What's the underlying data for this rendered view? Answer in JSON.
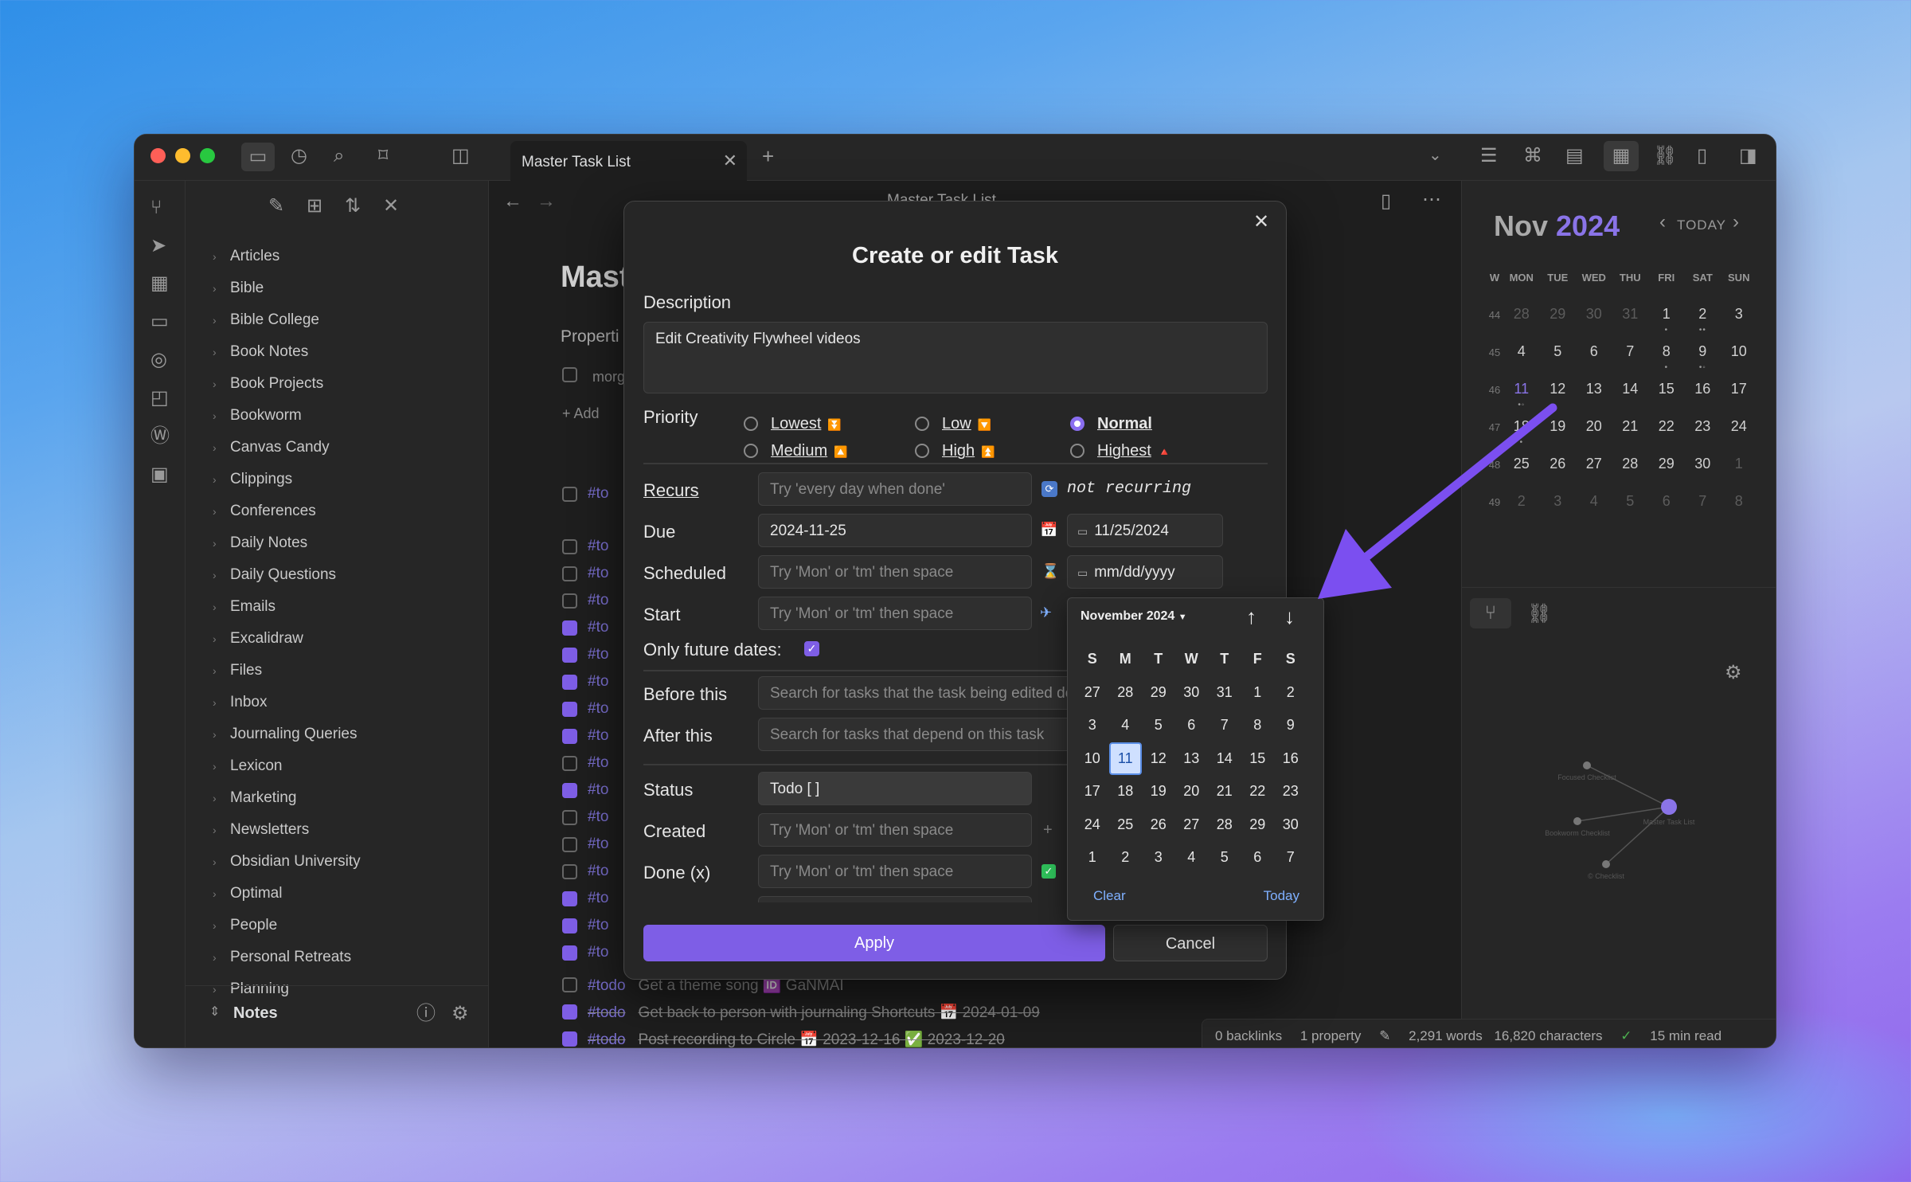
{
  "window": {
    "tab_title": "Master Task List",
    "view_header": "Master Task List"
  },
  "sidebar": {
    "folders": [
      "Articles",
      "Bible",
      "Bible College",
      "Book Notes",
      "Book Projects",
      "Bookworm",
      "Canvas Candy",
      "Clippings",
      "Conferences",
      "Daily Notes",
      "Daily Questions",
      "Emails",
      "Excalidraw",
      "Files",
      "Inbox",
      "Journaling Queries",
      "Lexicon",
      "Marketing",
      "Newsletters",
      "Obsidian University",
      "Optimal",
      "People",
      "Personal Retreats",
      "Planning"
    ],
    "vault_name": "Notes"
  },
  "note": {
    "title_partial": "Mast",
    "properties_partial": "Properti",
    "property_value_partial": "morg",
    "add_property_partial": "Add",
    "tag_partial": "#to",
    "tasks": [
      {
        "tag": "#todo",
        "text": "Get a theme song 🆔 GaNMAI",
        "done": false
      },
      {
        "tag": "#todo",
        "text": "Get back to person with journaling Shortcuts 📅 2024-01-09",
        "done": true
      },
      {
        "tag": "#todo",
        "text": "Post recording to Circle 📅 2023-12-16 ✅ 2023-12-20",
        "done": true
      }
    ]
  },
  "modal": {
    "title": "Create or edit Task",
    "description_label": "Description",
    "description_value": "Edit Creativity Flywheel videos",
    "priority_label": "Priority",
    "priorities": [
      {
        "label": "Lowest",
        "icon": "⏬",
        "selected": false
      },
      {
        "label": "Low",
        "icon": "🔽",
        "selected": false
      },
      {
        "label": "Normal",
        "icon": "",
        "selected": true
      },
      {
        "label": "Medium",
        "icon": "🔼",
        "selected": false
      },
      {
        "label": "High",
        "icon": "⏫",
        "selected": false
      },
      {
        "label": "Highest",
        "icon": "🔺",
        "selected": false
      }
    ],
    "recurs_label": "Recurs",
    "recurs_placeholder": "Try 'every day when done'",
    "recurs_status": "not recurring",
    "due_label": "Due",
    "due_value": "2024-11-25",
    "due_date_field": "11/25/2024",
    "scheduled_label": "Scheduled",
    "scheduled_placeholder": "Try 'Mon' or 'tm' then space",
    "scheduled_date_field": "mm/dd/yyyy",
    "start_label": "Start",
    "start_placeholder": "Try 'Mon' or 'tm' then space",
    "future_label": "Only future dates:",
    "before_label": "Before this",
    "before_placeholder": "Search for tasks that the task being edited depends on",
    "after_label": "After this",
    "after_placeholder": "Search for tasks that depend on this task",
    "status_label": "Status",
    "status_value": "Todo [ ]",
    "created_label": "Created",
    "created_placeholder": "Try 'Mon' or 'tm' then space",
    "done_label": "Done (x)",
    "done_placeholder": "Try 'Mon' or 'tm' then space",
    "apply_label": "Apply",
    "cancel_label": "Cancel"
  },
  "datepicker": {
    "month_label": "November 2024",
    "weekday_headers": [
      "S",
      "M",
      "T",
      "W",
      "T",
      "F",
      "S"
    ],
    "days": [
      "27",
      "28",
      "29",
      "30",
      "31",
      "1",
      "2",
      "3",
      "4",
      "5",
      "6",
      "7",
      "8",
      "9",
      "10",
      "11",
      "12",
      "13",
      "14",
      "15",
      "16",
      "17",
      "18",
      "19",
      "20",
      "21",
      "22",
      "23",
      "24",
      "25",
      "26",
      "27",
      "28",
      "29",
      "30",
      "1",
      "2",
      "3",
      "4",
      "5",
      "6",
      "7"
    ],
    "selected_day": "11",
    "clear_label": "Clear",
    "today_label": "Today"
  },
  "calendar": {
    "month": "Nov",
    "year": "2024",
    "today_label": "TODAY",
    "headers": [
      "W",
      "MON",
      "TUE",
      "WED",
      "THU",
      "FRI",
      "SAT",
      "SUN"
    ],
    "weeks": [
      [
        "44",
        "28",
        "29",
        "30",
        "31",
        "1",
        "2",
        "3"
      ],
      [
        "45",
        "4",
        "5",
        "6",
        "7",
        "8",
        "9",
        "10"
      ],
      [
        "46",
        "11",
        "12",
        "13",
        "14",
        "15",
        "16",
        "17"
      ],
      [
        "47",
        "18",
        "19",
        "20",
        "21",
        "22",
        "23",
        "24"
      ],
      [
        "48",
        "25",
        "26",
        "27",
        "28",
        "29",
        "30",
        "1"
      ],
      [
        "49",
        "2",
        "3",
        "4",
        "5",
        "6",
        "7",
        "8"
      ]
    ]
  },
  "graph": {
    "nodes": [
      "Focused Checklist",
      "Master Task List",
      "Bookworm Checklist",
      "© Checklist"
    ]
  },
  "status_bar": {
    "backlinks": "0 backlinks",
    "properties": "1 property",
    "words": "2,291 words",
    "characters": "16,820 characters",
    "read_time": "15 min read"
  },
  "colors": {
    "accent": "#7e5ee6",
    "arrow": "#7b4ff0",
    "link": "#7fb0ff"
  }
}
